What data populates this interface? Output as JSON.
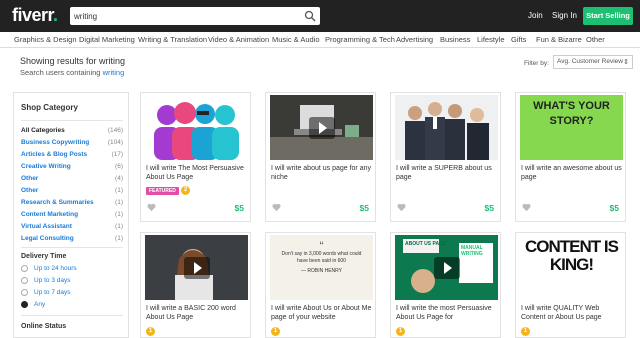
{
  "header": {
    "logo": "fiverr",
    "logo_mark": ".",
    "search_value": "writing",
    "join": "Join",
    "sign_in": "Sign In",
    "start_selling": "Start Selling"
  },
  "categories": [
    "Graphics & Design",
    "Digital Marketing",
    "Writing & Translation",
    "Video & Animation",
    "Music & Audio",
    "Programming & Tech",
    "Advertising",
    "Business",
    "Lifestyle",
    "Gifts",
    "Fun & Bizarre",
    "Other"
  ],
  "results": {
    "title": "Showing results for writing",
    "sub_prefix": "Search users containing",
    "sub_link": "writing",
    "filter_label": "Filter by:",
    "filter_value": "Avg. Customer Review"
  },
  "sidebar": {
    "heading": "Shop Category",
    "items": [
      {
        "label": "All Categories",
        "count": "(146)"
      },
      {
        "label": "Business Copywriting",
        "count": "(104)"
      },
      {
        "label": "Articles & Blog Posts",
        "count": "(17)"
      },
      {
        "label": "Creative Writing",
        "count": "(6)"
      },
      {
        "label": "Other",
        "count": "(4)"
      },
      {
        "label": "Other",
        "count": "(1)"
      },
      {
        "label": "Research & Summaries",
        "count": "(1)"
      },
      {
        "label": "Content Marketing",
        "count": "(1)"
      },
      {
        "label": "Virtual Assistant",
        "count": "(1)"
      },
      {
        "label": "Legal Consulting",
        "count": "(1)"
      }
    ],
    "delivery_heading": "Delivery Time",
    "delivery_options": [
      "Up to 24 hours",
      "Up to 3 days",
      "Up to 7 days",
      "Any"
    ],
    "delivery_selected": 3,
    "online_heading": "Online Status"
  },
  "gigs": [
    {
      "desc": "I will write The Most Persuasive About Us Page",
      "price": "$5",
      "badge": "FEATURED",
      "level": "2"
    },
    {
      "desc": "I will write about us page for any niche",
      "price": "$5"
    },
    {
      "desc": "I will write a SUPERB about us page",
      "price": "$5"
    },
    {
      "desc": "I will write an awesome about us page",
      "price": "$5",
      "thumb_text": "WHAT'S YOUR STORY?"
    },
    {
      "desc": "I will write a BASIC 200 word About Us Page",
      "price": "$5",
      "level": "1"
    },
    {
      "desc": "I will write About Us or About Me page of your website",
      "price": "$5",
      "level": "1",
      "quote": "Don't say in 3,000 words what could have been said in 600",
      "quote_author": "— ROBIN HENRY"
    },
    {
      "desc": "I will write the most Persuasive About Us Page for",
      "price": "$5",
      "level": "1",
      "thumb_text_a": "ABOUT US PAGE",
      "thumb_text_b": "MANUAL WRITING"
    },
    {
      "desc": "I will write QUALITY Web Content or About Us page",
      "price": "$5",
      "level": "1",
      "thumb_text": "CONTENT IS KING!"
    }
  ],
  "colors": {
    "accent": "#1dbf73",
    "link": "#1a7bd6",
    "featured": "#e24da8",
    "topbar": "#222222"
  }
}
